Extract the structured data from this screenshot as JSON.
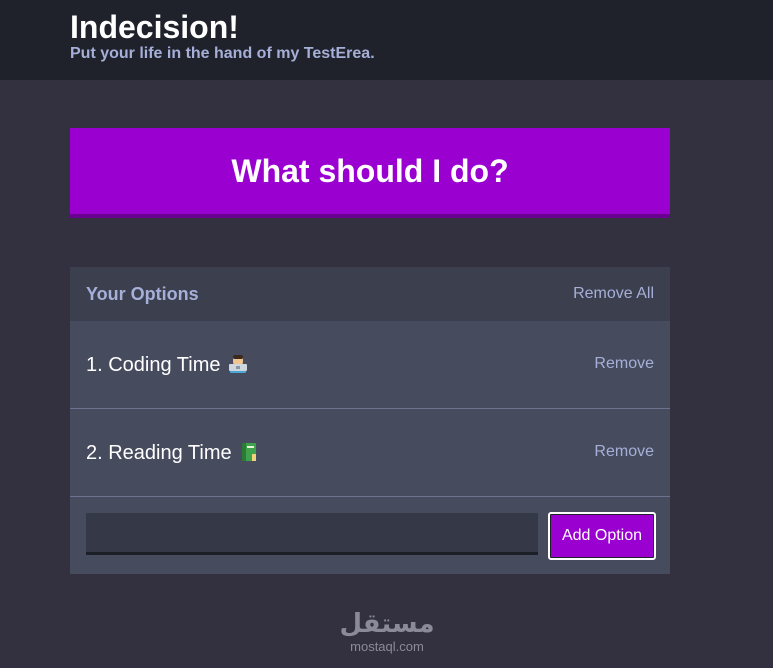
{
  "header": {
    "title": "Indecision!",
    "subtitle": "Put your life in the hand of my TestErea."
  },
  "action": {
    "label": "What should I do?"
  },
  "options_panel": {
    "title": "Your Options",
    "remove_all_label": "Remove All",
    "items": [
      {
        "text": "1. Coding Time",
        "emoji": "technologist-icon",
        "remove_label": "Remove"
      },
      {
        "text": "2. Reading Time",
        "emoji": "book-icon",
        "remove_label": "Remove"
      }
    ]
  },
  "add_form": {
    "input_value": "",
    "button_label": "Add Option"
  },
  "watermark": {
    "logo_text": "مستقل",
    "url": "mostaql.com"
  },
  "colors": {
    "background": "#333140",
    "header": "#20222b",
    "accent": "#9a00d0",
    "panel": "#464b5e",
    "panel_header": "#3c3f4e",
    "muted_text": "#a5afd7"
  }
}
